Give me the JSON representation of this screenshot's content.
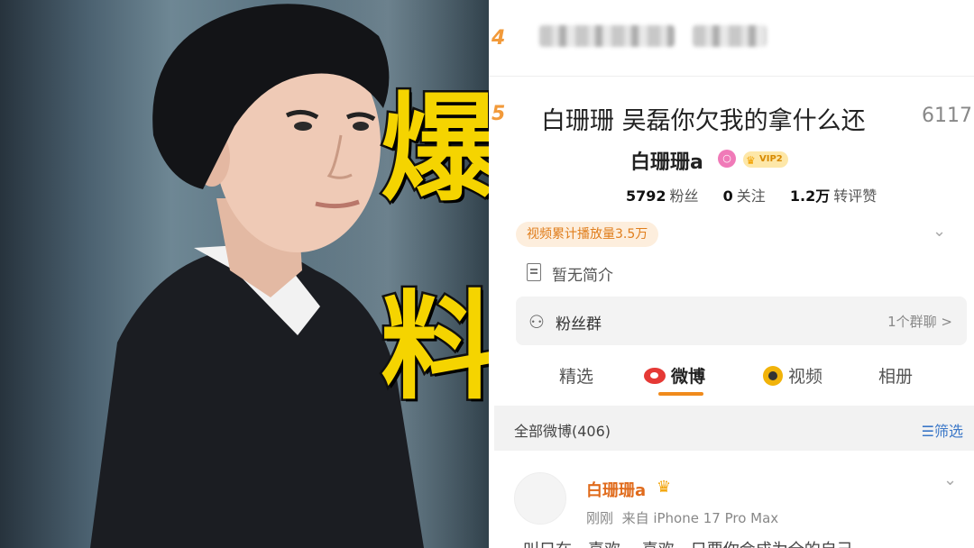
{
  "thumbnail": {
    "headline_chars": [
      "爆",
      "料"
    ],
    "headline_color": "#f5d400"
  },
  "hot_list": {
    "row4": {
      "rank": "4"
    },
    "row5": {
      "rank": "5",
      "title": "白珊珊 吴磊你欠我的拿什么还",
      "count": "6117"
    }
  },
  "profile": {
    "username": "白珊珊a",
    "vip_badge": "VIP2",
    "stats": {
      "fans_value": "5792",
      "fans_label": "粉丝",
      "following_value": "0",
      "following_label": "关注",
      "interactions_value": "1.2万",
      "interactions_label": "转评赞"
    },
    "video_play_tag": "视频累计播放量3.5万",
    "bio": "暂无简介",
    "fan_group": {
      "label": "粉丝群",
      "count": "1个群聊 >"
    }
  },
  "tabs": [
    {
      "label": "精选"
    },
    {
      "label": "微博",
      "active": true
    },
    {
      "label": "视频"
    },
    {
      "label": "相册"
    }
  ],
  "feed": {
    "all_label": "全部微博(406)",
    "filter_label": "筛选",
    "post": {
      "author": "白珊珊a",
      "time": "刚刚",
      "source": "来自 iPhone 17 Pro Max",
      "text_partial": "叫只在…喜欢 …喜欢…只要你会成为全的自己"
    }
  },
  "colors": {
    "accent_orange": "#f08b1c",
    "filter_blue": "#3c78c8",
    "rank_orange": "#f29a3a"
  }
}
